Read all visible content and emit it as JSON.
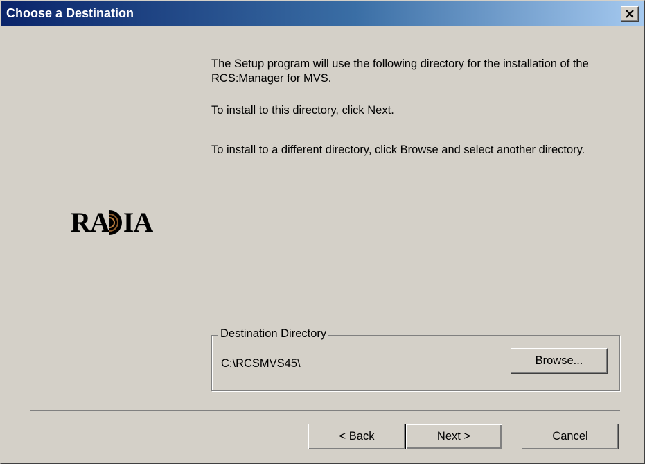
{
  "window": {
    "title": "Choose a Destination"
  },
  "content": {
    "paragraph1": "The Setup program will use the following directory for the installation of the RCS:Manager for MVS.",
    "paragraph2": "To install to this directory, click Next.",
    "paragraph3": "To install to a different directory, click Browse and select another directory."
  },
  "logo": {
    "text": "RADIA"
  },
  "destination": {
    "group_label": "Destination Directory",
    "path": "C:\\RCSMVS45\\",
    "browse_label": "Browse..."
  },
  "buttons": {
    "back_label": "< Back",
    "next_label": "Next >",
    "cancel_label": "Cancel"
  },
  "colors": {
    "titlebar_start": "#0a246a",
    "titlebar_end": "#a6caf0",
    "dialog_bg": "#d4d0c8"
  }
}
